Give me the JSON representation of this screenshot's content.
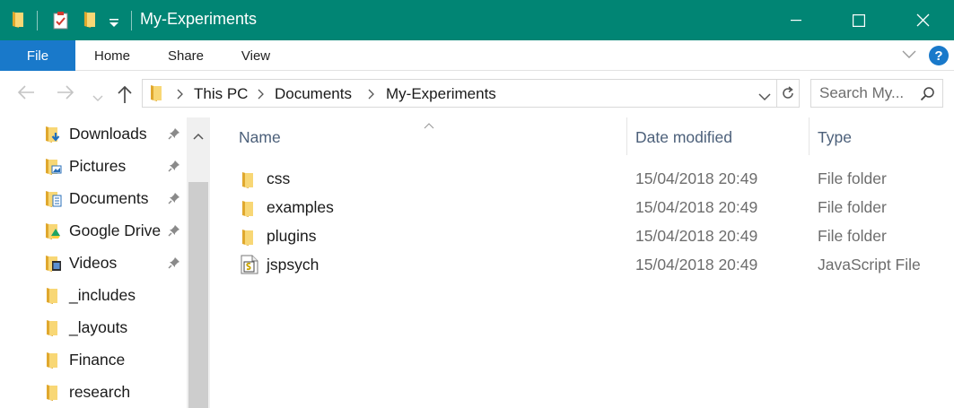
{
  "window": {
    "title": "My-Experiments"
  },
  "ribbon": {
    "tabs": [
      "File",
      "Home",
      "Share",
      "View"
    ],
    "help_label": "?"
  },
  "address": {
    "crumbs": [
      "This PC",
      "Documents",
      "My-Experiments"
    ],
    "search_placeholder": "Search My..."
  },
  "nav": {
    "items": [
      {
        "label": "Downloads",
        "icon": "downloads-folder-icon",
        "pinned": true
      },
      {
        "label": "Pictures",
        "icon": "pictures-folder-icon",
        "pinned": true
      },
      {
        "label": "Documents",
        "icon": "documents-folder-icon",
        "pinned": true
      },
      {
        "label": "Google Drive",
        "icon": "google-drive-folder-icon",
        "pinned": true
      },
      {
        "label": "Videos",
        "icon": "videos-folder-icon",
        "pinned": true
      },
      {
        "label": "_includes",
        "icon": "folder-icon",
        "pinned": false
      },
      {
        "label": "_layouts",
        "icon": "folder-icon",
        "pinned": false
      },
      {
        "label": "Finance",
        "icon": "folder-icon",
        "pinned": false
      },
      {
        "label": "research",
        "icon": "folder-icon",
        "pinned": false
      }
    ]
  },
  "files": {
    "columns": {
      "name": "Name",
      "date": "Date modified",
      "type": "Type"
    },
    "rows": [
      {
        "name": "css",
        "date": "15/04/2018 20:49",
        "type": "File folder",
        "icon": "folder-icon"
      },
      {
        "name": "examples",
        "date": "15/04/2018 20:49",
        "type": "File folder",
        "icon": "folder-icon"
      },
      {
        "name": "plugins",
        "date": "15/04/2018 20:49",
        "type": "File folder",
        "icon": "folder-icon"
      },
      {
        "name": "jspsych",
        "date": "15/04/2018 20:49",
        "type": "JavaScript File",
        "icon": "javascript-file-icon"
      }
    ]
  },
  "colors": {
    "titlebar": "#018574",
    "file_tab": "#1979ca",
    "folder_yellow": "#f8d775",
    "folder_dark": "#e0a82e",
    "header_text": "#4c607a",
    "secondary_text": "#6d6d6d"
  }
}
